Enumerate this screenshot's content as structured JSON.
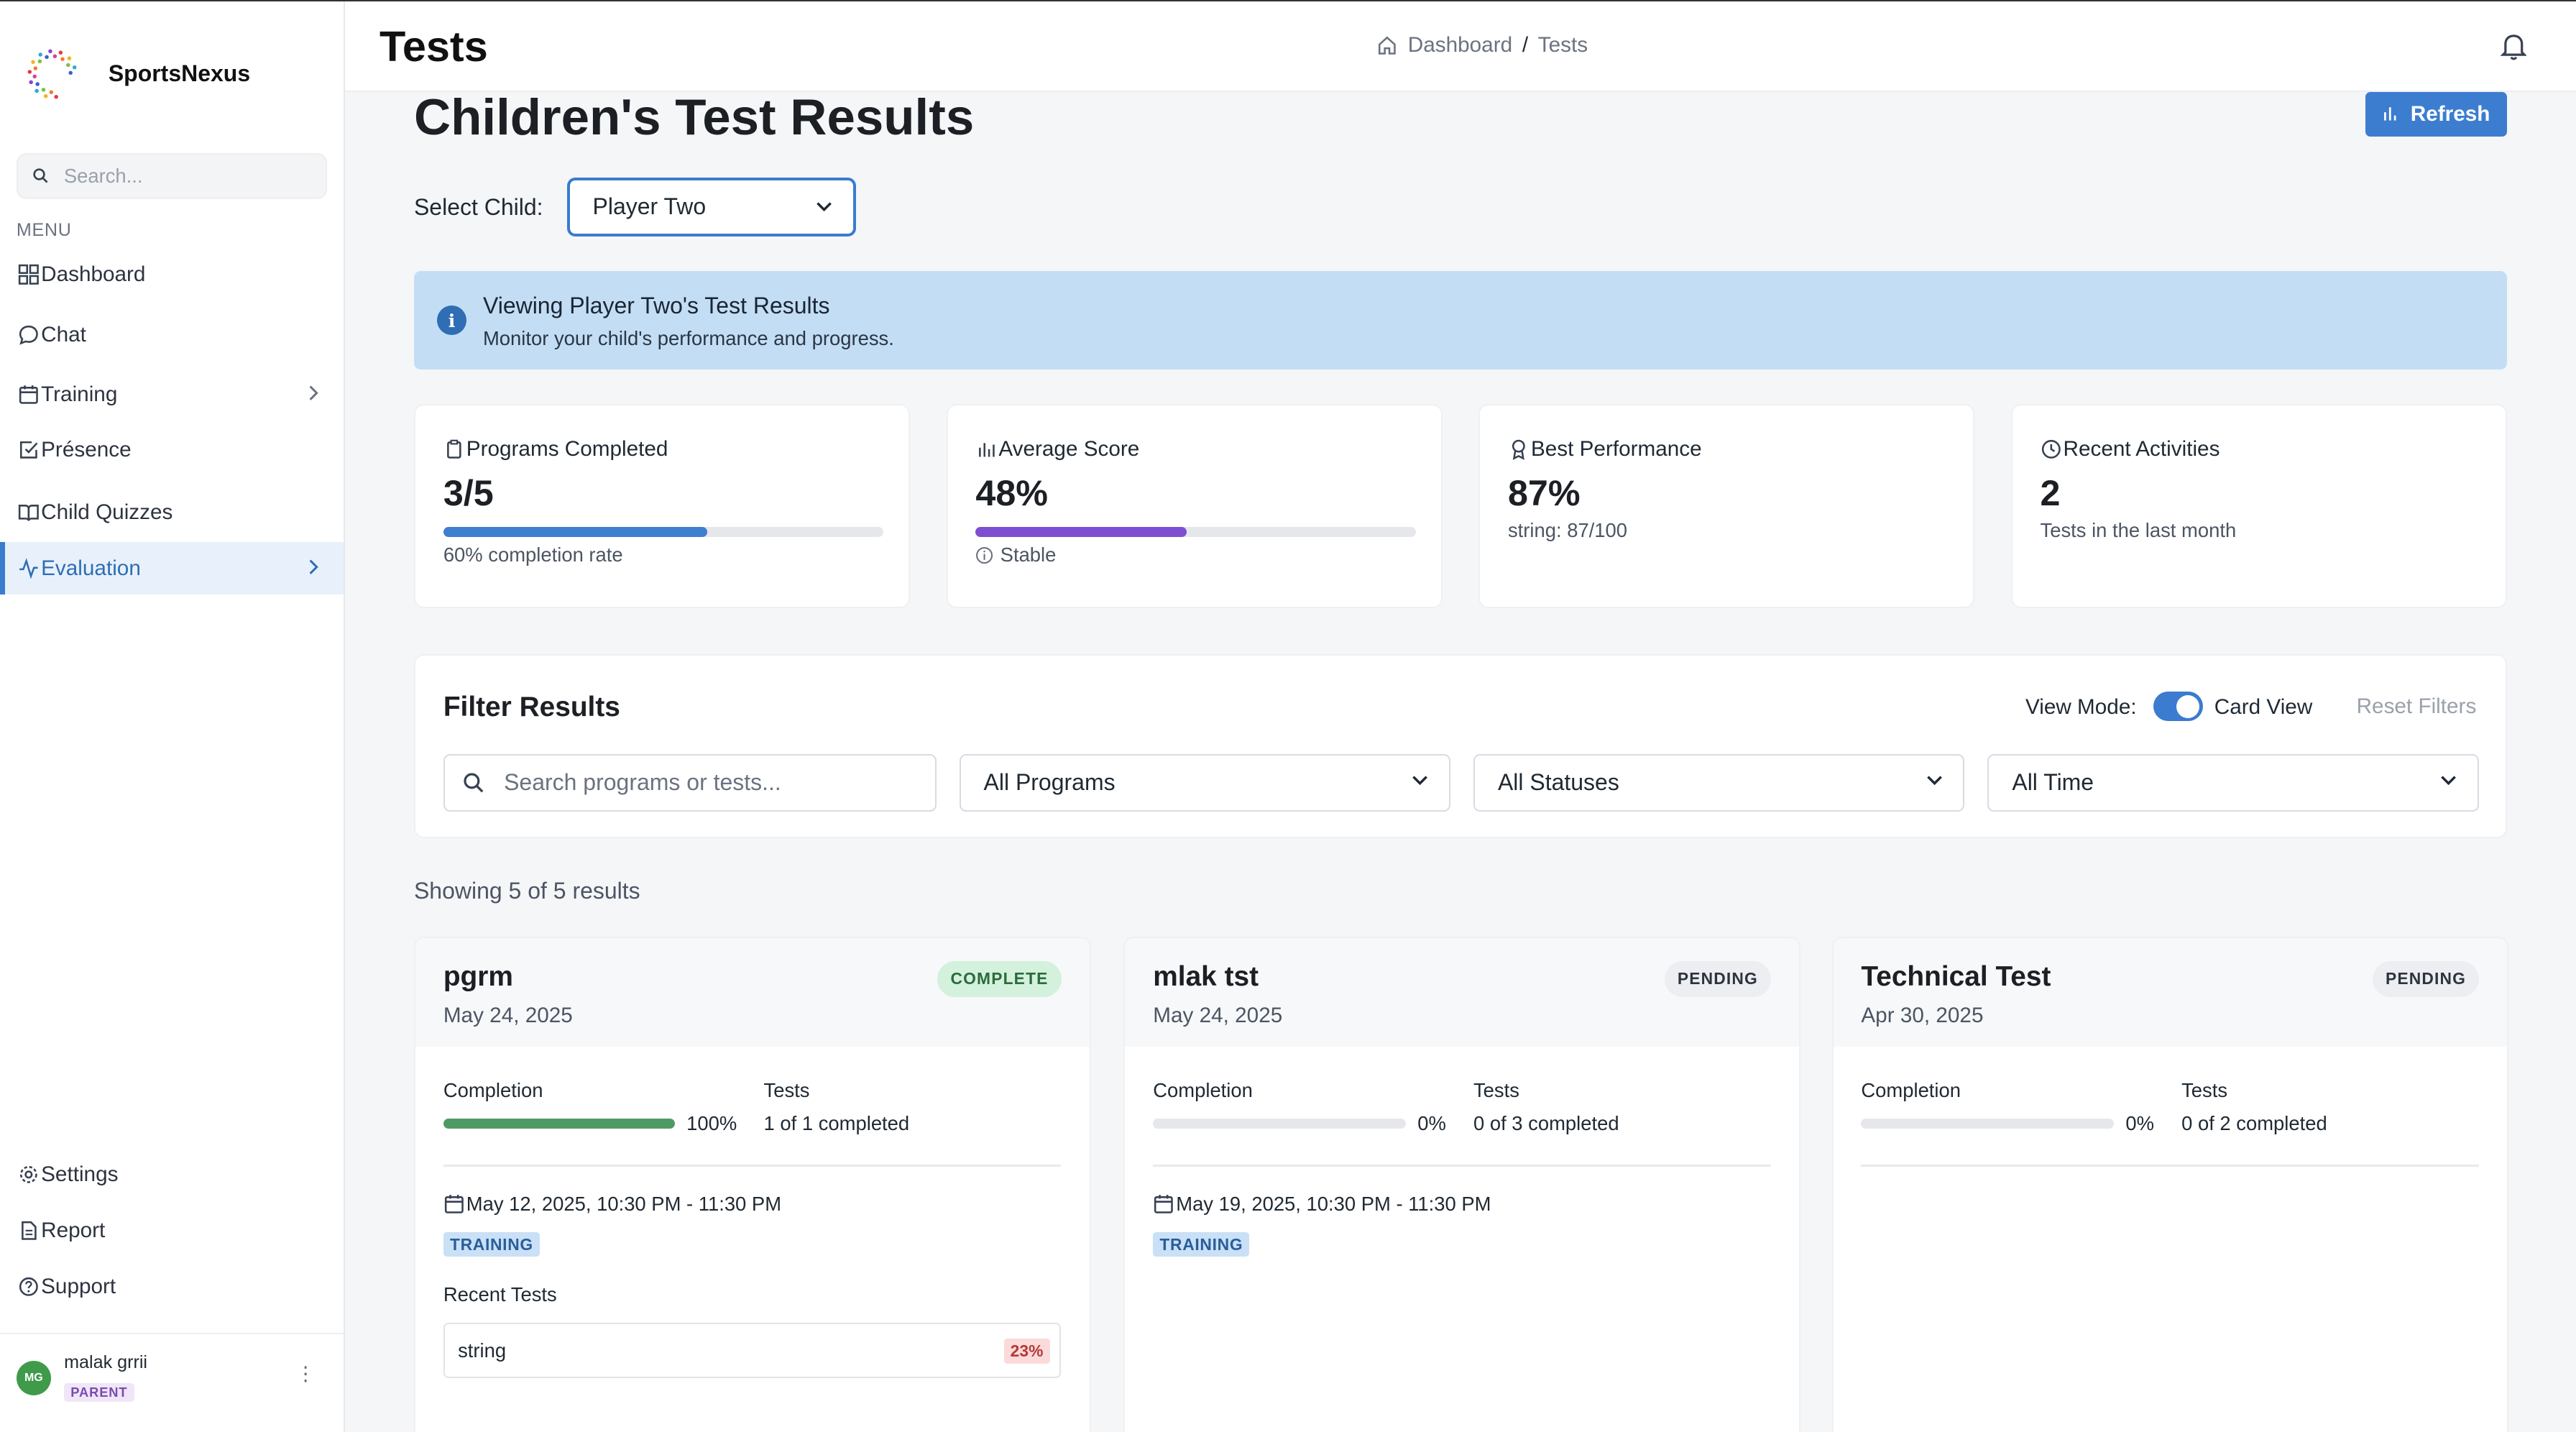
{
  "app": {
    "name": "SportsNexus"
  },
  "sidebar": {
    "search_placeholder": "Search...",
    "menu_label": "MENU",
    "items": [
      {
        "label": "Dashboard",
        "icon": "grid-icon"
      },
      {
        "label": "Chat",
        "icon": "chat-bubble-icon"
      },
      {
        "label": "Training",
        "icon": "calendar-icon",
        "has_submenu": true
      },
      {
        "label": "Présence",
        "icon": "check-square-icon"
      },
      {
        "label": "Child Quizzes",
        "icon": "book-icon"
      },
      {
        "label": "Evaluation",
        "icon": "activity-icon",
        "has_submenu": true,
        "active": true
      }
    ],
    "bottom_items": [
      {
        "label": "Settings",
        "icon": "gear-icon"
      },
      {
        "label": "Report",
        "icon": "document-icon"
      },
      {
        "label": "Support",
        "icon": "help-circle-icon"
      }
    ],
    "user": {
      "initials": "MG",
      "name": "malak grrii",
      "role": "PARENT"
    }
  },
  "header": {
    "title": "Tests",
    "breadcrumb": [
      "Dashboard",
      "Tests"
    ],
    "breadcrumb_separator": "/"
  },
  "main": {
    "page_title": "Children's Test Results",
    "refresh_label": "Refresh",
    "select_child_label": "Select Child:",
    "selected_child": "Player Two",
    "alert": {
      "title": "Viewing Player Two's Test Results",
      "message": "Monitor your child's performance and progress."
    },
    "stats": [
      {
        "label": "Programs Completed",
        "value": "3/5",
        "sub": "60% completion rate",
        "progress": 0.6,
        "color": "#3f7fcf",
        "icon": "clipboard-icon"
      },
      {
        "label": "Average Score",
        "value": "48%",
        "sub": "Stable",
        "progress": 0.48,
        "color": "#7e4fd0",
        "icon": "bar-chart-icon"
      },
      {
        "label": "Best Performance",
        "value": "87%",
        "sub": "string: 87/100",
        "icon": "award-icon"
      },
      {
        "label": "Recent Activities",
        "value": "2",
        "sub": "Tests in the last month",
        "icon": "clock-icon"
      }
    ],
    "filter": {
      "title": "Filter Results",
      "view_mode_label": "View Mode:",
      "view_mode_value": "Card View",
      "reset_label": "Reset Filters",
      "search_placeholder": "Search programs or tests...",
      "program_select": "All Programs",
      "status_select": "All Statuses",
      "time_select": "All Time"
    },
    "showing_text": "Showing 5 of 5 results",
    "cards": [
      {
        "title": "pgrm",
        "date": "May 24, 2025",
        "status": "COMPLETE",
        "completion_label": "Completion",
        "completion_pct": "100%",
        "completion": 1.0,
        "tests_label": "Tests",
        "tests_value": "1 of 1 completed",
        "schedule": "May 12, 2025, 10:30 PM - 11:30 PM",
        "tag": "TRAINING",
        "recent_label": "Recent Tests",
        "recent": [
          {
            "name": "string",
            "score": "23%"
          }
        ]
      },
      {
        "title": "mlak tst",
        "date": "May 24, 2025",
        "status": "PENDING",
        "completion_label": "Completion",
        "completion_pct": "0%",
        "completion": 0.0,
        "tests_label": "Tests",
        "tests_value": "0 of 3 completed",
        "schedule": "May 19, 2025, 10:30 PM - 11:30 PM",
        "tag": "TRAINING"
      },
      {
        "title": "Technical Test",
        "date": "Apr 30, 2025",
        "status": "PENDING",
        "completion_label": "Completion",
        "completion_pct": "0%",
        "completion": 0.0,
        "tests_label": "Tests",
        "tests_value": "0 of 2 completed"
      }
    ]
  },
  "colors": {
    "accent": "#3c7dd0",
    "alert_bg": "#c3def4",
    "success": "#4e9a64"
  }
}
